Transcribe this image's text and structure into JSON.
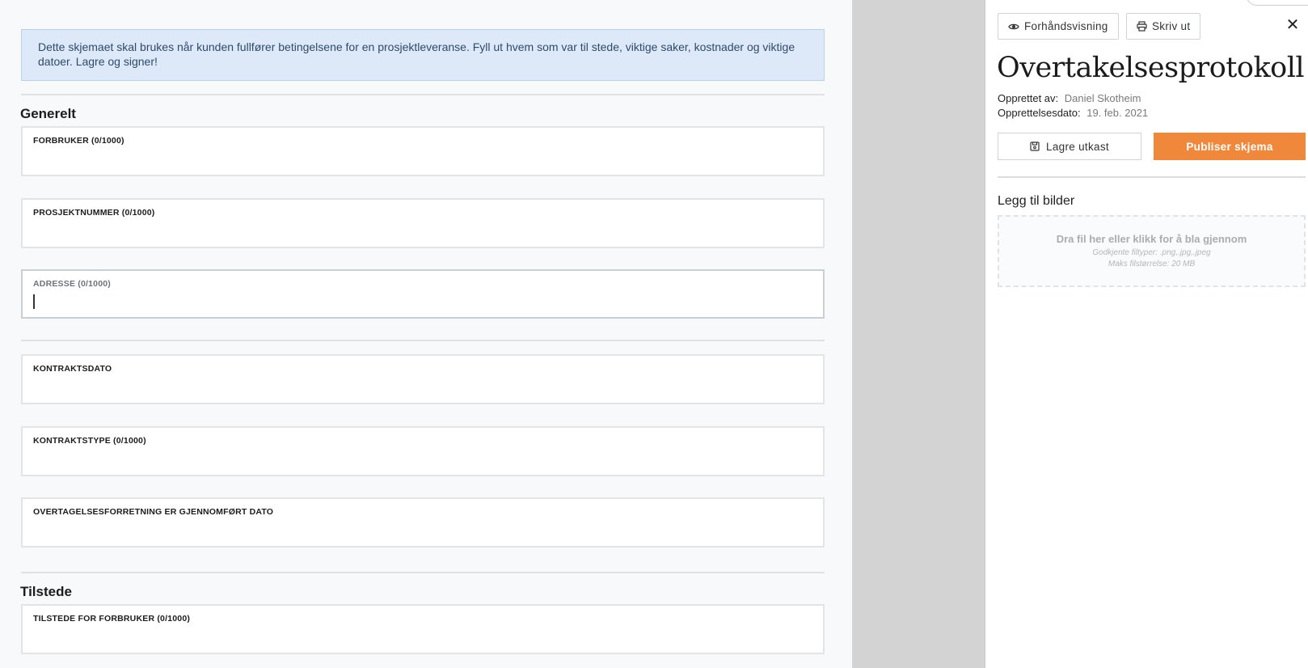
{
  "form": {
    "info_text": "Dette skjemaet skal brukes når kunden fullfører betingelsene for en prosjektleveranse. Fyll ut hvem som var til stede, viktige saker, kostnader og viktige datoer. Lagre og signer!",
    "sections": {
      "general": "Generelt",
      "present": "Tilstede"
    },
    "fields": {
      "forbruker": "FORBRUKER (0/1000)",
      "prosjektnummer": "PROSJEKTNUMMER (0/1000)",
      "adresse": "ADRESSE (0/1000)",
      "kontraktsdato": "KONTRAKTSDATO",
      "kontraktstype": "KONTRAKTSTYPE (0/1000)",
      "overtagelse_dato": "OVERTAGELSESFORRETNING ER GJENNOMFØRT DATO",
      "tilstede_forbruker": "TILSTEDE FOR FORBRUKER (0/1000)"
    }
  },
  "panel": {
    "preview_label": "Forhåndsvisning",
    "print_label": "Skriv ut",
    "close_symbol": "✕",
    "title": "Overtakelsesprotokoll",
    "created_by_label": "Opprettet av:",
    "created_by_value": "Daniel Skotheim",
    "created_date_label": "Opprettelsesdato:",
    "created_date_value": "19. feb. 2021",
    "save_draft_label": "Lagre utkast",
    "publish_label": "Publiser skjema",
    "publish_color": "#f0883c",
    "images_title": "Legg til bilder",
    "dropzone": {
      "main": "Dra fil her eller klikk for å bla gjennom",
      "types": "Godkjente filtyper: .png,.jpg,.jpeg",
      "max_size": "Maks filstørrelse: 20 MB"
    }
  }
}
